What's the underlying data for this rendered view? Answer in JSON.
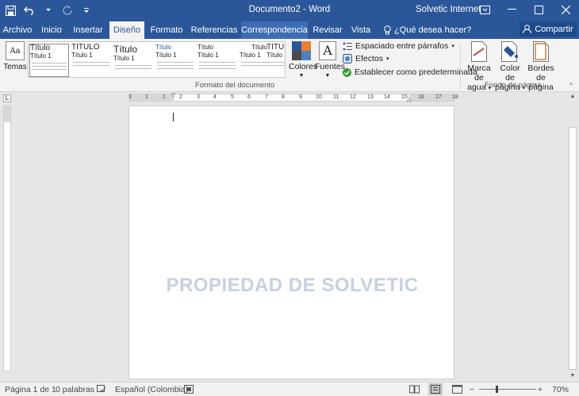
{
  "titlebar": {
    "document_title": "Documento2 - Word",
    "account": "Solvetic Internet",
    "save_icon": "save-icon",
    "undo_icon": "undo-icon",
    "redo_icon": "redo-icon",
    "customize_icon": "customize-qat-icon"
  },
  "tabs": [
    {
      "label": "Archivo"
    },
    {
      "label": "Inicio"
    },
    {
      "label": "Insertar"
    },
    {
      "label": "Diseño"
    },
    {
      "label": "Formato"
    },
    {
      "label": "Referencias"
    },
    {
      "label": "Correspondencia"
    },
    {
      "label": "Revisar"
    },
    {
      "label": "Vista"
    }
  ],
  "tellme": {
    "label": "¿Qué desea hacer?"
  },
  "share": {
    "label": "Compartir"
  },
  "ribbon": {
    "temas_label": "Temas",
    "temas_glyph": "Aa",
    "gallery": [
      {
        "title": "Título",
        "subtitle": "Título 1"
      },
      {
        "title": "TÍTULO",
        "subtitle": "Título 1"
      },
      {
        "title": "Título",
        "subtitle": "Título 1"
      },
      {
        "title": "Título",
        "subtitle": "Título 1"
      },
      {
        "title": "Título",
        "subtitle": "Título 1"
      },
      {
        "title": "Título",
        "subtitle": "Título 1"
      },
      {
        "title": "TÍTULO",
        "subtitle": "Título 1"
      }
    ],
    "colores_label": "Colores",
    "fuentes_label": "Fuentes",
    "fuentes_glyph": "A",
    "espaciado_label": "Espaciado entre párrafos",
    "efectos_label": "Efectos",
    "establecer_label": "Establecer como predeterminada",
    "group_formato_label": "Formato del documento",
    "marca_label_1": "Marca de",
    "marca_label_2": "agua",
    "color_label_1": "Color de",
    "color_label_2": "página",
    "bordes_label_1": "Bordes",
    "bordes_label_2": "de página",
    "group_fondo_label": "Fondo de página"
  },
  "ruler": {
    "tab_selector": "L",
    "numbers": [
      "3",
      "1",
      "1",
      "2",
      "3",
      "4",
      "5",
      "6",
      "7",
      "8",
      "9",
      "10",
      "11",
      "12",
      "13",
      "14",
      "15",
      "16",
      "17",
      "18"
    ]
  },
  "document": {
    "watermark": "PROPIEDAD DE SOLVETIC"
  },
  "status": {
    "page": "Página 1 de 1",
    "words": "0 palabras",
    "language": "Español (Colombia)",
    "zoom_minus": "−",
    "zoom_plus": "+",
    "zoom": "70%",
    "zoom_level": 0.7
  },
  "colors": {
    "brand": "#2b579a",
    "watermark": "#c6d1df",
    "ribbon_bg": "#f3f3f3",
    "canvas_bg": "#e6e6e6"
  }
}
